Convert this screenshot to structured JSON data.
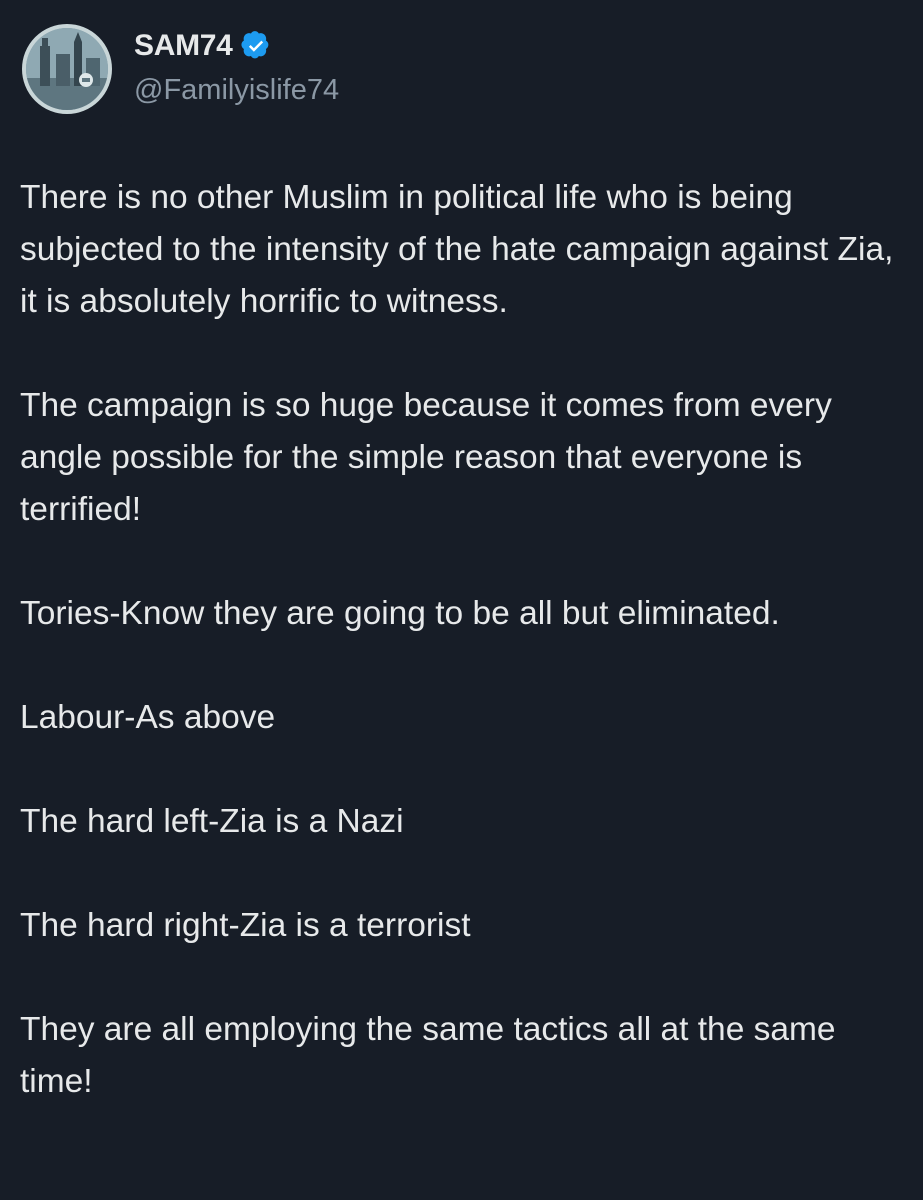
{
  "post": {
    "author": {
      "display_name": "SAM74",
      "handle": "@Familyislife74",
      "verified": true,
      "verified_color": "#1d9bf0",
      "avatar_icon": "avatar-image"
    },
    "paragraphs": [
      "There is no other Muslim in political life who is being subjected to the intensity of the hate campaign against Zia, it is absolutely horrific to witness.",
      "The campaign is so huge because it comes from every angle possible for the simple reason that everyone is terrified!",
      "Tories-Know they are going to be all but eliminated.",
      "Labour-As above",
      "The hard left-Zia is a Nazi",
      "The hard right-Zia is a terrorist",
      "They are all employing the same tactics all at the same time!"
    ]
  },
  "colors": {
    "background": "#171d27",
    "text_primary": "#e7e9ea",
    "text_secondary": "#8b98a5"
  }
}
